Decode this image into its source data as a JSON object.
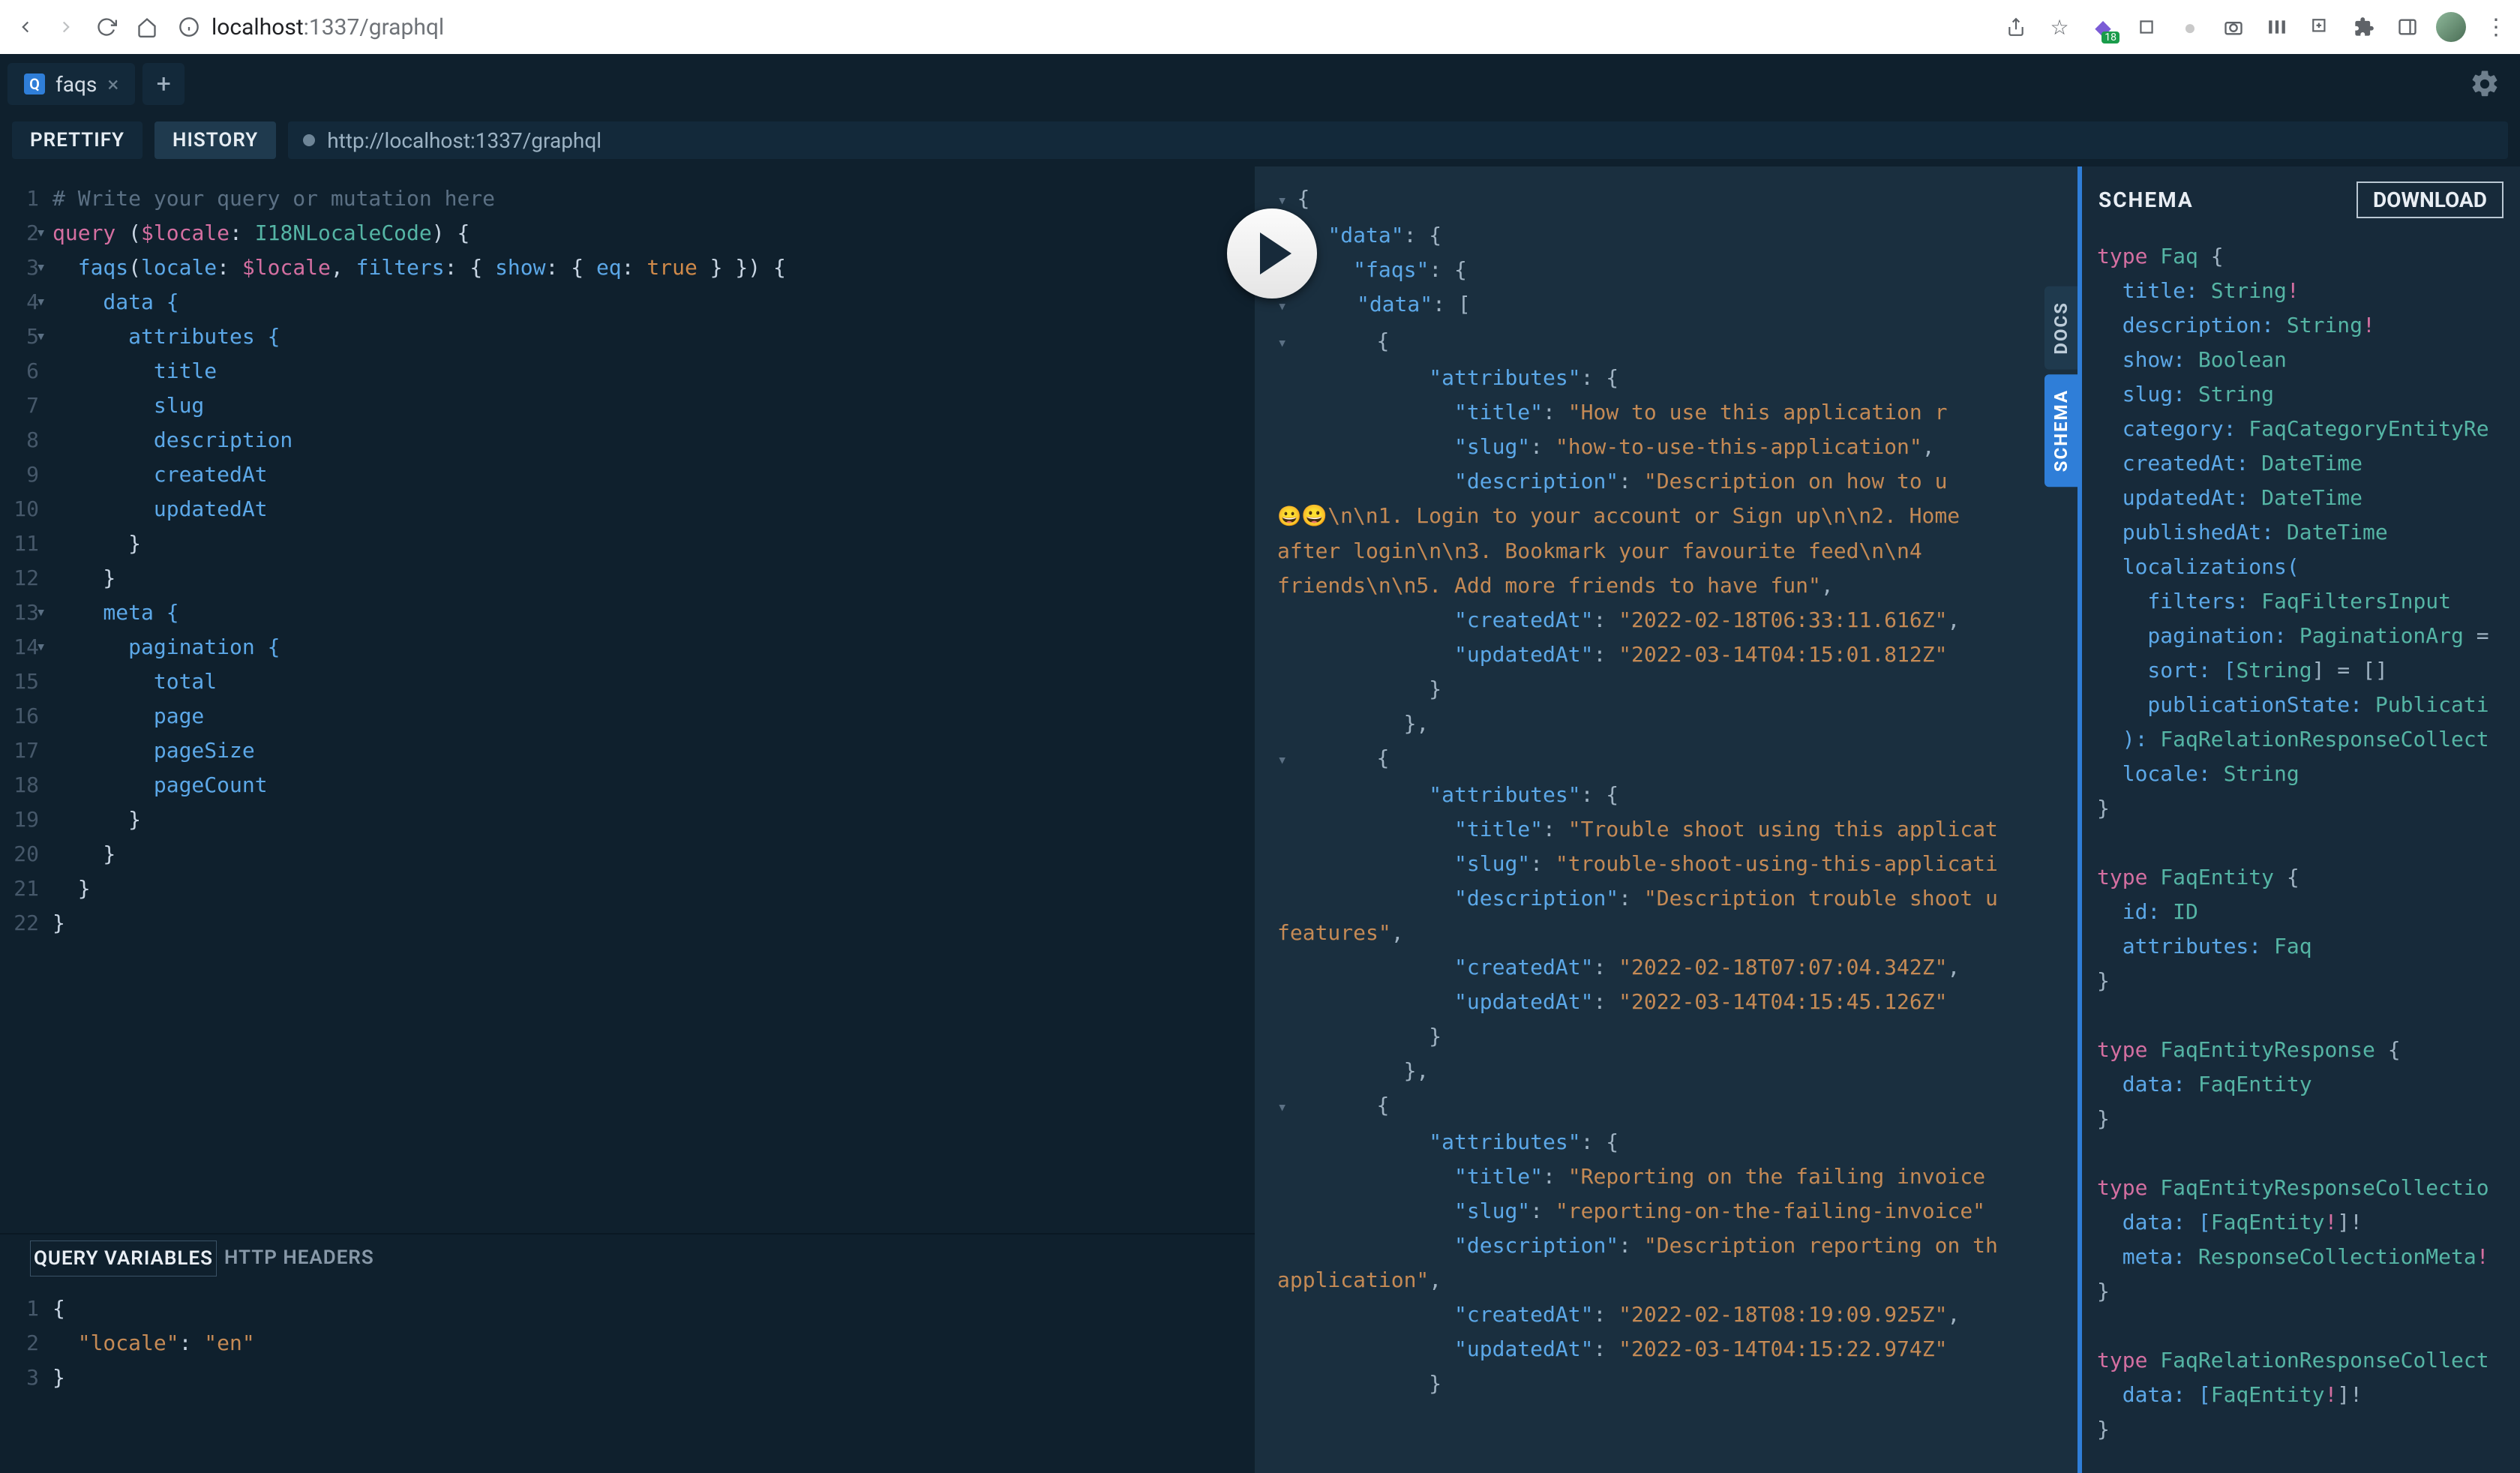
{
  "chrome": {
    "url_host": "localhost",
    "url_port_path": ":1337/graphql"
  },
  "tabs": {
    "active_label": "faqs",
    "active_badge": "Q"
  },
  "toolbar": {
    "prettify": "PRETTIFY",
    "history": "HISTORY",
    "endpoint": "http://localhost:1337/graphql"
  },
  "editor": {
    "gutter": "1\n2\n3\n4\n5\n6\n7\n8\n9\n10\n11\n12\n13\n14\n15\n16\n17\n18\n19\n20\n21\n22",
    "folds": "\n▾\n▾\n▾\n▾\n\n\n\n\n\n\n\n▾\n▾\n\n\n\n\n\n\n\n",
    "l1_comment": "# Write your query or mutation here",
    "l2_query": "query",
    "l2_open": " (",
    "l2_var": "$locale",
    "l2_colon": ": ",
    "l2_type": "I18NLocaleCode",
    "l2_close": ") {",
    "l3_pre": "  ",
    "l3_fn": "faqs",
    "l3_p1": "(",
    "l3_k1": "locale",
    "l3_c1": ": ",
    "l3_v1": "$locale",
    "l3_c2": ", ",
    "l3_k2": "filters",
    "l3_c3": ": { ",
    "l3_k3": "show",
    "l3_c4": ": { ",
    "l3_k4": "eq",
    "l3_c5": ": ",
    "l3_bool": "true",
    "l3_tail": " } }) {",
    "l4": "    data {",
    "l5": "      attributes {",
    "l6": "        title",
    "l7": "        slug",
    "l8": "        description",
    "l9": "        createdAt",
    "l10": "        updatedAt",
    "l11": "      }",
    "l12": "    }",
    "l13": "    meta {",
    "l14": "      pagination {",
    "l15": "        total",
    "l16": "        page",
    "l17": "        pageSize",
    "l18": "        pageCount",
    "l19": "      }",
    "l20": "    }",
    "l21": "  }",
    "l22": "}"
  },
  "vars_panel": {
    "tab_qvars": "QUERY VARIABLES",
    "tab_headers": "HTTP HEADERS",
    "gutter": "1\n2\n3",
    "l1": "{",
    "l2_key": "\"locale\"",
    "l2_sep": ": ",
    "l2_val": "\"en\"",
    "l3": "}"
  },
  "rails": {
    "docs": "DOCS",
    "schema": "SCHEMA"
  },
  "schema": {
    "title": "SCHEMA",
    "download": "DOWNLOAD",
    "lines": {
      "a1": "type ",
      "a1n": "Faq",
      "a1e": " {",
      "a2": "  title: ",
      "a2t": "String",
      "a2b": "!",
      "a3": "  description: ",
      "a3t": "String",
      "a3b": "!",
      "a4": "  show: ",
      "a4t": "Boolean",
      "a5": "  slug: ",
      "a5t": "String",
      "a6": "  category: ",
      "a6t": "FaqCategoryEntityRe",
      "a7": "  createdAt: ",
      "a7t": "DateTime",
      "a8": "  updatedAt: ",
      "a8t": "DateTime",
      "a9": "  publishedAt: ",
      "a9t": "DateTime",
      "a10": "  localizations(",
      "a11": "    filters: ",
      "a11t": "FaqFiltersInput",
      "a12": "    pagination: ",
      "a12t": "PaginationArg",
      "a12e": " =",
      "a13": "    sort: [",
      "a13t": "String",
      "a13e": "] = []",
      "a14": "    publicationState: ",
      "a14t": "Publicati",
      "a15": "  ): ",
      "a15t": "FaqRelationResponseCollect",
      "a16": "  locale: ",
      "a16t": "String",
      "a17": "}",
      "b1": "type ",
      "b1n": "FaqEntity",
      "b1e": " {",
      "b2": "  id: ",
      "b2t": "ID",
      "b3": "  attributes: ",
      "b3t": "Faq",
      "b4": "}",
      "c1": "type ",
      "c1n": "FaqEntityResponse",
      "c1e": " {",
      "c2": "  data: ",
      "c2t": "FaqEntity",
      "c3": "}",
      "d1": "type ",
      "d1n": "FaqEntityResponseCollectio",
      "d2": "  data: [",
      "d2t": "FaqEntity",
      "d2b": "!",
      "d2e": "]!",
      "d3": "  meta: ",
      "d3t": "ResponseCollectionMeta",
      "d3b": "!",
      "d4": "}",
      "e1": "type ",
      "e1n": "FaqRelationResponseCollect",
      "e2": "  data: [",
      "e2t": "FaqEntity",
      "e2b": "!",
      "e2e": "]!",
      "e3": "}"
    }
  },
  "result": {
    "r1a": "▾ ",
    "r1": "{",
    "r2a": "    ",
    "r2k": "\"data\"",
    "r2": ": {",
    "r3a": "      ",
    "r3k": "\"faqs\"",
    "r3": ": {",
    "r4a": "▾       ",
    "r4k": "\"data\"",
    "r4": ": [",
    "r5a": "▾         ",
    "r5": "{",
    "r6a": "            ",
    "r6k": "\"attributes\"",
    "r6": ": {",
    "r7a": "              ",
    "r7k": "\"title\"",
    "r7c": ": ",
    "r7v": "\"How to use this application r",
    "r8a": "              ",
    "r8k": "\"slug\"",
    "r8c": ": ",
    "r8v": "\"how-to-use-this-application\"",
    "r8e": ",",
    "r9a": "              ",
    "r9k": "\"description\"",
    "r9c": ": ",
    "r9v": "\"Description on how to u",
    "r10": "😀\\n\\n1. Login to your account or Sign up\\n\\n2. Home",
    "r11": "after login\\n\\n3. Bookmark your favourite feed\\n\\n4",
    "r12": "friends\\n\\n5. Add more friends to have fun\"",
    "r12e": ",",
    "r13a": "              ",
    "r13k": "\"createdAt\"",
    "r13c": ": ",
    "r13v": "\"2022-02-18T06:33:11.616Z\"",
    "r13e": ",",
    "r14a": "              ",
    "r14k": "\"updatedAt\"",
    "r14c": ": ",
    "r14v": "\"2022-03-14T04:15:01.812Z\"",
    "r15": "            }",
    "r16": "          },",
    "r17a": "▾         ",
    "r17": "{",
    "r18a": "            ",
    "r18k": "\"attributes\"",
    "r18": ": {",
    "r19a": "              ",
    "r19k": "\"title\"",
    "r19c": ": ",
    "r19v": "\"Trouble shoot using this applicat",
    "r20a": "              ",
    "r20k": "\"slug\"",
    "r20c": ": ",
    "r20v": "\"trouble-shoot-using-this-applicati",
    "r21a": "              ",
    "r21k": "\"description\"",
    "r21c": ": ",
    "r21v": "\"Description trouble shoot u",
    "r22": "features\"",
    "r22e": ",",
    "r23a": "              ",
    "r23k": "\"createdAt\"",
    "r23c": ": ",
    "r23v": "\"2022-02-18T07:07:04.342Z\"",
    "r23e": ",",
    "r24a": "              ",
    "r24k": "\"updatedAt\"",
    "r24c": ": ",
    "r24v": "\"2022-03-14T04:15:45.126Z\"",
    "r25": "            }",
    "r26": "          },",
    "r27a": "▾         ",
    "r27": "{",
    "r28a": "            ",
    "r28k": "\"attributes\"",
    "r28": ": {",
    "r29a": "              ",
    "r29k": "\"title\"",
    "r29c": ": ",
    "r29v": "\"Reporting on the failing invoice",
    "r30a": "              ",
    "r30k": "\"slug\"",
    "r30c": ": ",
    "r30v": "\"reporting-on-the-failing-invoice\"",
    "r31a": "              ",
    "r31k": "\"description\"",
    "r31c": ": ",
    "r31v": "\"Description reporting on th",
    "r32": "application\"",
    "r32e": ",",
    "r33a": "              ",
    "r33k": "\"createdAt\"",
    "r33c": ": ",
    "r33v": "\"2022-02-18T08:19:09.925Z\"",
    "r33e": ",",
    "r34a": "              ",
    "r34k": "\"updatedAt\"",
    "r34c": ": ",
    "r34v": "\"2022-03-14T04:15:22.974Z\"",
    "r35": "            }"
  }
}
